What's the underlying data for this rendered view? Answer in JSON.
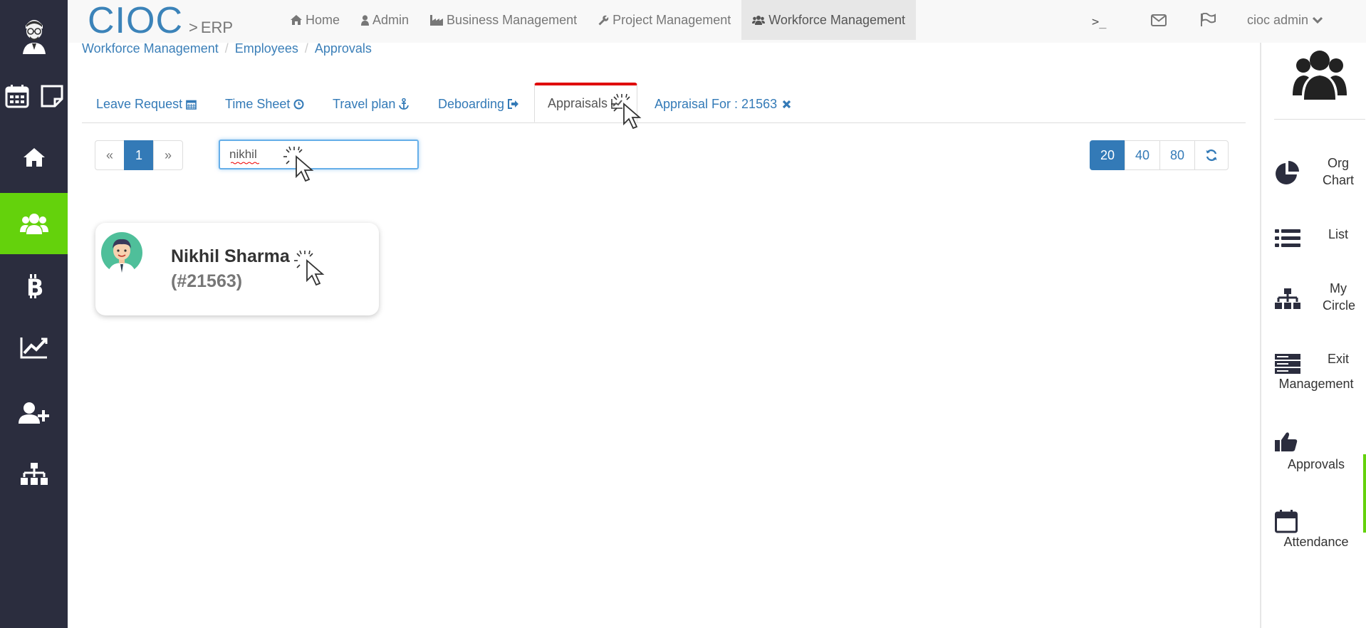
{
  "brand": {
    "logo": "CIOC",
    "separator": ">",
    "product": "ERP"
  },
  "top_menu": [
    {
      "label": "Home",
      "icon": "home-icon"
    },
    {
      "label": "Admin",
      "icon": "user-icon"
    },
    {
      "label": "Business Management",
      "icon": "industry-icon"
    },
    {
      "label": "Project Management",
      "icon": "wrench-icon"
    },
    {
      "label": "Workforce Management",
      "icon": "users-icon",
      "active": true
    }
  ],
  "top_right": {
    "terminal": ">_",
    "user": "cioc admin"
  },
  "breadcrumb": [
    "Workforce Management",
    "Employees",
    "Approvals"
  ],
  "tabs": [
    {
      "label": "Leave Request",
      "icon": "calendar-icon"
    },
    {
      "label": "Time Sheet",
      "icon": "clock-icon"
    },
    {
      "label": "Travel plan",
      "icon": "anchor-icon"
    },
    {
      "label": "Deboarding",
      "icon": "sign-out-icon"
    },
    {
      "label": "Appraisals",
      "icon": "chart-icon",
      "active": true
    },
    {
      "label": "Appraisal For : 21563",
      "icon": "close-icon"
    }
  ],
  "pager": {
    "prev": "«",
    "page": "1",
    "next": "»"
  },
  "search": {
    "value": "nikhil"
  },
  "page_sizes": [
    "20",
    "40",
    "80"
  ],
  "page_size_selected": "20",
  "employee": {
    "name": "Nikhil Sharma",
    "id": "(#21563)"
  },
  "right_menu": [
    {
      "label": "Org Chart",
      "icon": "pie-chart-icon"
    },
    {
      "label": "List",
      "icon": "list-icon"
    },
    {
      "label": "My Circle",
      "icon": "sitemap-icon"
    },
    {
      "label": "Exit Management",
      "icon": "server-icon"
    },
    {
      "label": "Approvals",
      "icon": "thumbs-up-icon"
    },
    {
      "label": "Attendance",
      "icon": "calendar-icon"
    }
  ],
  "colors": {
    "sidebar_bg": "#2b2d3e",
    "sidebar_active": "#64d20c",
    "link": "#337ab7",
    "active_tab_top": "#e00000"
  }
}
